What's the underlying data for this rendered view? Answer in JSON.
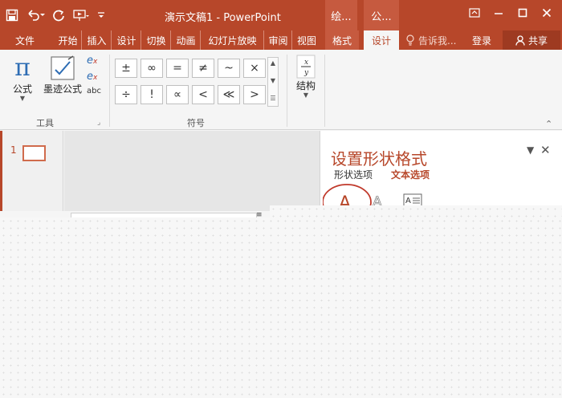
{
  "window": {
    "title": "演示文稿1 - PowerPoint",
    "context_groups": [
      "绘...",
      "公..."
    ]
  },
  "tabs": [
    "文件",
    "开始",
    "插入",
    "设计",
    "切换",
    "动画",
    "幻灯片放映",
    "审阅",
    "视图",
    "格式",
    "设计"
  ],
  "active_tab_index": 10,
  "tell_me": "告诉我...",
  "sign_in": "登录",
  "share": "共享",
  "ribbon": {
    "tools_group": {
      "label": "工具",
      "equation_label": "公式",
      "ink_equation_label": "墨迹公式",
      "abc_label": "abc"
    },
    "symbols_group": {
      "label": "符号",
      "symbols": [
        "±",
        "∞",
        "=",
        "≠",
        "~",
        "×",
        "÷",
        "!",
        "∝",
        "<",
        "≪",
        ">"
      ]
    },
    "structures_group": {
      "label": "结构"
    }
  },
  "slides": {
    "first_number": "1"
  },
  "format_pane": {
    "title": "设置形状格式",
    "shape_options": "形状选项",
    "text_options": "文本选项"
  },
  "colors": {
    "brand": "#b7472a",
    "ribbon_bg": "#f5f5f5"
  }
}
